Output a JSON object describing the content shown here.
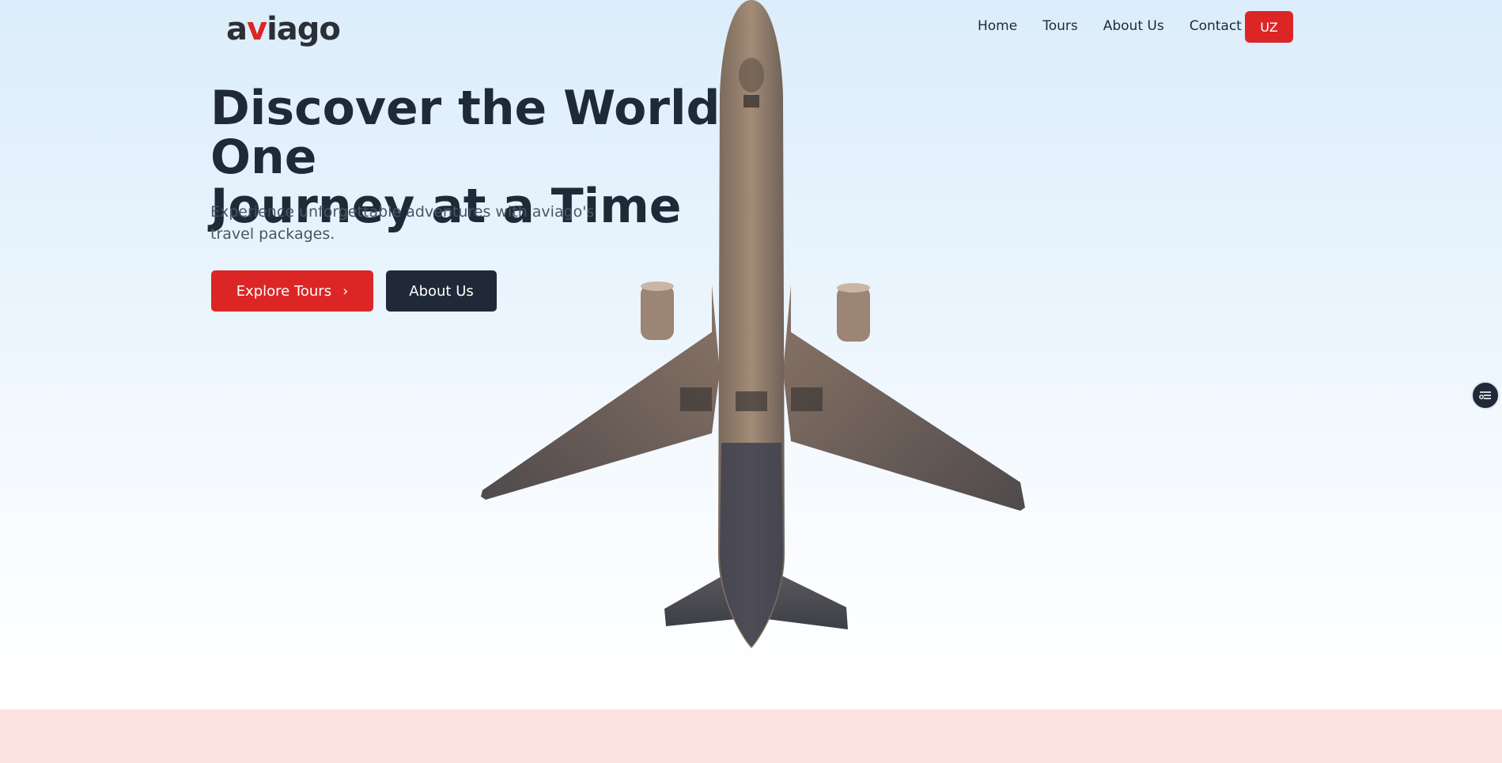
{
  "brand": {
    "logo_pre": "a",
    "logo_accent": "v",
    "logo_post": "iago",
    "accent_color": "#dc2626"
  },
  "nav": {
    "items": [
      {
        "label": "Home"
      },
      {
        "label": "Tours"
      },
      {
        "label": "About Us"
      },
      {
        "label": "Contact"
      }
    ],
    "language_button": "UZ"
  },
  "hero": {
    "headline_line1": "Discover the World One",
    "headline_line2": "Journey at a Time",
    "subtitle": "Experience unforgettable adventures with aviago's travel packages.",
    "primary_button": "Explore Tours",
    "secondary_button": "About Us",
    "image_icon": "airplane-image"
  },
  "widget": {
    "icon": "settings-sliders-icon"
  }
}
